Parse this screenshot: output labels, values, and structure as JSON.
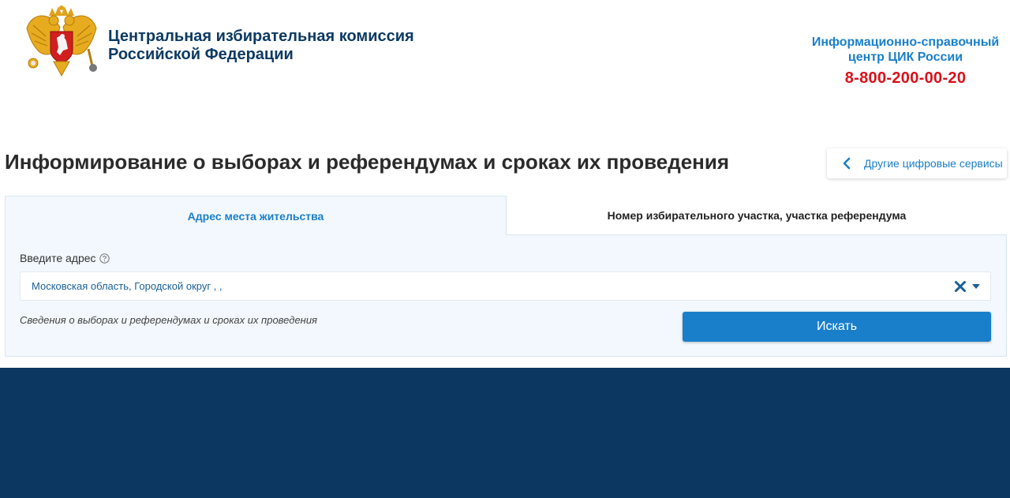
{
  "header": {
    "org_name_line1": "Центральная избирательная комиссия",
    "org_name_line2": "Российской Федерации",
    "hotline_line1": "Информационно-справочный",
    "hotline_line2": "центр ЦИК России",
    "hotline_phone": "8-800-200-00-20",
    "emblem_icon": "russian-coat-of-arms-icon"
  },
  "page": {
    "title": "Информирование о выборах и референдумах и сроках их проведения",
    "services_button_label": "Другие цифровые сервисы"
  },
  "tabs": [
    {
      "label": "Адрес места жительства",
      "active": true
    },
    {
      "label": "Номер избирательного участка, участка референдума",
      "active": false
    }
  ],
  "form": {
    "field_label": "Введите адрес",
    "address_value": "Московская область, Городской округ , ,",
    "hint": "Сведения о выборах и референдумах и сроках их проведения",
    "search_button_label": "Искать"
  },
  "colors": {
    "accent": "#1a7fcb",
    "brand_dark": "#0d3a63",
    "phone_red": "#d8101a",
    "footer_bg": "#0b3760",
    "panel_bg": "#f2f8fd"
  }
}
